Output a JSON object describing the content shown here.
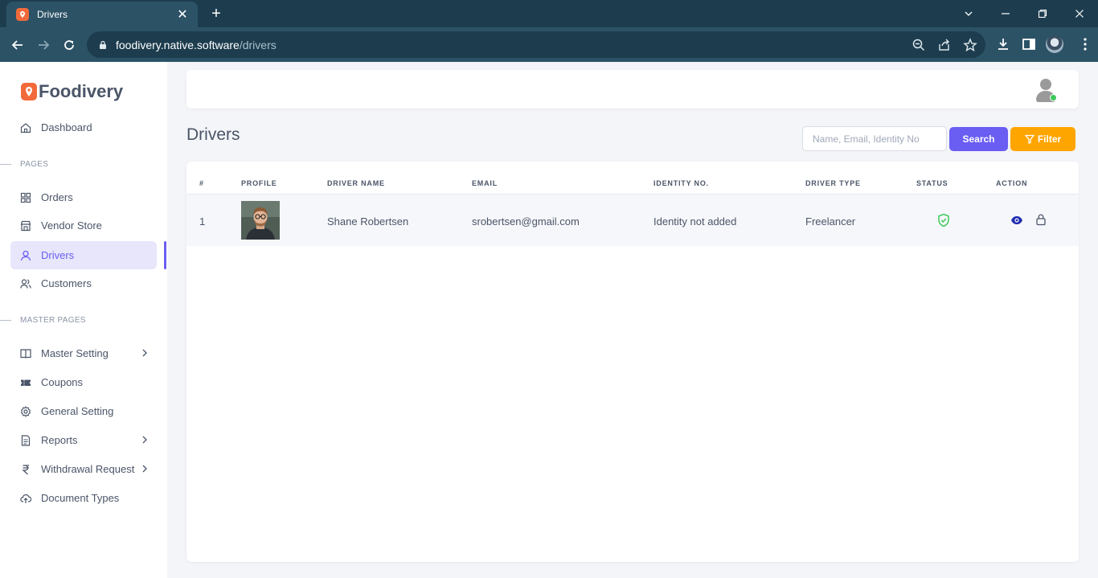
{
  "browser": {
    "tab_title": "Drivers",
    "tab_close": "✕",
    "new_tab": "+",
    "url_host": "foodivery.native.software",
    "url_path": "/drivers"
  },
  "app": {
    "brand": "Foodivery",
    "brand_color": "#f26a3b",
    "accent_color": "#6a5df2"
  },
  "sidebar": {
    "items": [
      {
        "label": "Dashboard",
        "icon": "home-icon"
      },
      {
        "label": "Orders",
        "icon": "grid-icon"
      },
      {
        "label": "Vendor Store",
        "icon": "store-icon"
      },
      {
        "label": "Drivers",
        "icon": "user-icon",
        "active": true
      },
      {
        "label": "Customers",
        "icon": "users-icon"
      },
      {
        "label": "Master Setting",
        "icon": "book-icon",
        "has_submenu": true
      },
      {
        "label": "Coupons",
        "icon": "ticket-icon"
      },
      {
        "label": "General Setting",
        "icon": "gear-icon"
      },
      {
        "label": "Reports",
        "icon": "file-icon",
        "has_submenu": true
      },
      {
        "label": "Withdrawal Request",
        "icon": "rupee-icon",
        "has_submenu": true
      },
      {
        "label": "Document Types",
        "icon": "cloud-upload-icon"
      }
    ],
    "sections": [
      "PAGES",
      "MASTER PAGES"
    ]
  },
  "main": {
    "title": "Drivers",
    "search_placeholder": "Name, Email, Identity No",
    "search_button": "Search",
    "filter_button": "Filter"
  },
  "table": {
    "headers": [
      "#",
      "PROFILE",
      "DRIVER NAME",
      "EMAIL",
      "IDENTITY NO.",
      "DRIVER TYPE",
      "STATUS",
      "ACTION"
    ],
    "rows": [
      {
        "index": "1",
        "name": "Shane Robertsen",
        "email": "srobertsen@gmail.com",
        "identity": "Identity not added",
        "type": "Freelancer",
        "status_color": "#3ec95a"
      }
    ]
  }
}
